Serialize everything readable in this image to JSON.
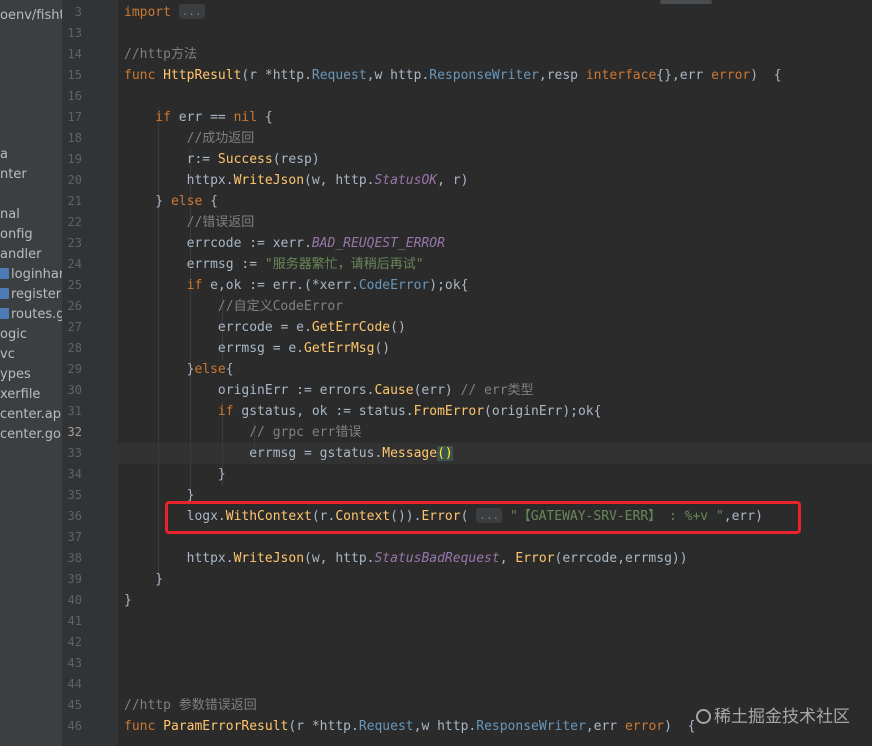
{
  "project_sidebar": {
    "items": [
      {
        "label": "oenv/fisht",
        "file": false
      },
      {
        "label": "a",
        "file": false
      },
      {
        "label": "nter",
        "file": false
      },
      {
        "label": "nal",
        "file": false
      },
      {
        "label": "onfig",
        "file": false
      },
      {
        "label": "andler",
        "file": false
      },
      {
        "label": "loginhand",
        "file": true
      },
      {
        "label": "registerh",
        "file": true
      },
      {
        "label": "routes.go",
        "file": true
      },
      {
        "label": "ogic",
        "file": false
      },
      {
        "label": "vc",
        "file": false
      },
      {
        "label": "ypes",
        "file": false
      },
      {
        "label": "xerfile",
        "file": false
      },
      {
        "label": "center.api",
        "file": false
      },
      {
        "label": "center.go",
        "file": false
      }
    ]
  },
  "editor": {
    "current_line": "32",
    "line_numbers": [
      "3",
      "13",
      "14",
      "15",
      "16",
      "17",
      "18",
      "19",
      "20",
      "21",
      "22",
      "23",
      "24",
      "25",
      "26",
      "27",
      "28",
      "29",
      "30",
      "31",
      "32",
      "33",
      "34",
      "35",
      "36",
      "37",
      "38",
      "39",
      "40",
      "41",
      "42",
      "43",
      "44",
      "45",
      "46"
    ],
    "lines": [
      [
        {
          "t": "import ",
          "c": "kw"
        },
        {
          "t": "...",
          "c": "fold"
        }
      ],
      [],
      [
        {
          "t": "//http方法",
          "c": "cm"
        }
      ],
      [
        {
          "t": "func ",
          "c": "kw"
        },
        {
          "t": "HttpResult",
          "c": "fn"
        },
        {
          "t": "(r *",
          "c": "pk"
        },
        {
          "t": "http",
          "c": "pk"
        },
        {
          "t": ".",
          "c": "pk"
        },
        {
          "t": "Request",
          "c": "ty"
        },
        {
          "t": ",w ",
          "c": "pk"
        },
        {
          "t": "http",
          "c": "pk"
        },
        {
          "t": ".",
          "c": "pk"
        },
        {
          "t": "ResponseWriter",
          "c": "ty"
        },
        {
          "t": ",resp ",
          "c": "pk"
        },
        {
          "t": "interface",
          "c": "kw"
        },
        {
          "t": "{},err ",
          "c": "pk"
        },
        {
          "t": "error",
          "c": "kw"
        },
        {
          "t": ")  {",
          "c": "pk"
        }
      ],
      [],
      [
        {
          "t": "    if ",
          "c": "kw"
        },
        {
          "t": "err == ",
          "c": "pk"
        },
        {
          "t": "nil",
          "c": "kw"
        },
        {
          "t": " {",
          "c": "pk"
        }
      ],
      [
        {
          "t": "        //成功返回",
          "c": "cm"
        }
      ],
      [
        {
          "t": "        r:= ",
          "c": "pk"
        },
        {
          "t": "Success",
          "c": "mt"
        },
        {
          "t": "(resp)",
          "c": "pk"
        }
      ],
      [
        {
          "t": "        httpx.",
          "c": "pk"
        },
        {
          "t": "WriteJson",
          "c": "mt"
        },
        {
          "t": "(w, http.",
          "c": "pk"
        },
        {
          "t": "StatusOK",
          "c": "cl"
        },
        {
          "t": ", r)",
          "c": "pk"
        }
      ],
      [
        {
          "t": "    } ",
          "c": "pk"
        },
        {
          "t": "else",
          "c": "kw"
        },
        {
          "t": " {",
          "c": "pk"
        }
      ],
      [
        {
          "t": "        //错误返回",
          "c": "cm"
        }
      ],
      [
        {
          "t": "        errcode := xerr.",
          "c": "pk"
        },
        {
          "t": "BAD_REUQEST_ERROR",
          "c": "cl"
        }
      ],
      [
        {
          "t": "        errmsg := ",
          "c": "pk"
        },
        {
          "t": "\"服务器繁忙，请稍后再试\"",
          "c": "st"
        }
      ],
      [
        {
          "t": "        if ",
          "c": "kw"
        },
        {
          "t": "e,ok := err.(*xerr.",
          "c": "pk"
        },
        {
          "t": "CodeError",
          "c": "ty"
        },
        {
          "t": ");ok{",
          "c": "pk"
        }
      ],
      [
        {
          "t": "            //自定义CodeError",
          "c": "cm"
        }
      ],
      [
        {
          "t": "            errcode = e.",
          "c": "pk"
        },
        {
          "t": "GetErrCode",
          "c": "mt"
        },
        {
          "t": "()",
          "c": "pk"
        }
      ],
      [
        {
          "t": "            errmsg = e.",
          "c": "pk"
        },
        {
          "t": "GetErrMsg",
          "c": "mt"
        },
        {
          "t": "()",
          "c": "pk"
        }
      ],
      [
        {
          "t": "        }",
          "c": "pk"
        },
        {
          "t": "else",
          "c": "kw"
        },
        {
          "t": "{",
          "c": "pk"
        }
      ],
      [
        {
          "t": "            originErr := errors.",
          "c": "pk"
        },
        {
          "t": "Cause",
          "c": "mt"
        },
        {
          "t": "(err) ",
          "c": "pk"
        },
        {
          "t": "// err类型",
          "c": "cm"
        }
      ],
      [
        {
          "t": "            if ",
          "c": "kw"
        },
        {
          "t": "gstatus, ok := status.",
          "c": "pk"
        },
        {
          "t": "FromError",
          "c": "mt"
        },
        {
          "t": "(originErr);ok{",
          "c": "pk"
        }
      ],
      [
        {
          "t": "                // grpc err错误",
          "c": "cm"
        }
      ],
      [
        {
          "t": "                errmsg = gstatus.",
          "c": "pk"
        },
        {
          "t": "Message",
          "c": "mt"
        },
        {
          "t": "()",
          "c": "matchparen"
        }
      ],
      [
        {
          "t": "            }",
          "c": "pk"
        }
      ],
      [
        {
          "t": "        }",
          "c": "pk"
        }
      ],
      [
        {
          "t": "        logx.",
          "c": "pk"
        },
        {
          "t": "WithContext",
          "c": "mt"
        },
        {
          "t": "(r.",
          "c": "pk"
        },
        {
          "t": "Context",
          "c": "mt"
        },
        {
          "t": "()).",
          "c": "pk"
        },
        {
          "t": "Error",
          "c": "mt"
        },
        {
          "t": "( ",
          "c": "pk"
        },
        {
          "t": "...",
          "c": "hint"
        },
        {
          "t": " ",
          "c": "pk"
        },
        {
          "t": "\"【GATEWAY-SRV-ERR】 : %+v \"",
          "c": "st"
        },
        {
          "t": ",err)",
          "c": "pk"
        }
      ],
      [],
      [
        {
          "t": "        httpx.",
          "c": "pk"
        },
        {
          "t": "WriteJson",
          "c": "mt"
        },
        {
          "t": "(w, http.",
          "c": "pk"
        },
        {
          "t": "StatusBadRequest",
          "c": "cl"
        },
        {
          "t": ", ",
          "c": "pk"
        },
        {
          "t": "Error",
          "c": "mt"
        },
        {
          "t": "(errcode,errmsg))",
          "c": "pk"
        }
      ],
      [
        {
          "t": "    }",
          "c": "pk"
        }
      ],
      [
        {
          "t": "}",
          "c": "pk"
        }
      ],
      [],
      [],
      [],
      [],
      [
        {
          "t": "//http 参数错误返回",
          "c": "cm"
        }
      ],
      [
        {
          "t": "func ",
          "c": "kw"
        },
        {
          "t": "ParamErrorResult",
          "c": "fn"
        },
        {
          "t": "(r *http.",
          "c": "pk"
        },
        {
          "t": "Request",
          "c": "ty"
        },
        {
          "t": ",w http.",
          "c": "pk"
        },
        {
          "t": "ResponseWriter",
          "c": "ty"
        },
        {
          "t": ",err ",
          "c": "pk"
        },
        {
          "t": "error",
          "c": "kw"
        },
        {
          "t": ")  {",
          "c": "pk"
        }
      ]
    ]
  },
  "watermark": {
    "text": "稀土掘金技术社区"
  },
  "colors": {
    "annotation_box": "#e8232b",
    "editor_bg": "#2b2b2b",
    "gutter_bg": "#313335"
  }
}
